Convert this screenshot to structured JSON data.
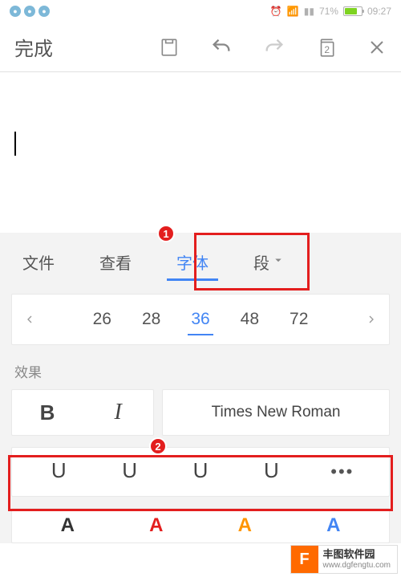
{
  "statusbar": {
    "battery_percent": "71%",
    "time": "09:27"
  },
  "toolbar": {
    "done_label": "完成",
    "page_count": "2"
  },
  "tabs": {
    "items": [
      {
        "label": "文件"
      },
      {
        "label": "查看"
      },
      {
        "label": "字体"
      },
      {
        "label": "段"
      }
    ],
    "active_index": 2
  },
  "callouts": {
    "c1": "1",
    "c2": "2"
  },
  "font_sizes": {
    "items": [
      "26",
      "28",
      "36",
      "48",
      "72"
    ],
    "active_index": 2
  },
  "sections": {
    "effects_label": "效果"
  },
  "format": {
    "bold_label": "B",
    "italic_label": "I",
    "font_name": "Times New Roman",
    "more_label": "•••",
    "underline_glyph": "U"
  },
  "colors": {
    "items": [
      "#333333",
      "#e31e1e",
      "#ff9500",
      "#4285f4"
    ],
    "glyph": "A"
  },
  "watermark": {
    "logo_letter": "F",
    "title": "丰图软件园",
    "url": "www.dgfengtu.com"
  }
}
